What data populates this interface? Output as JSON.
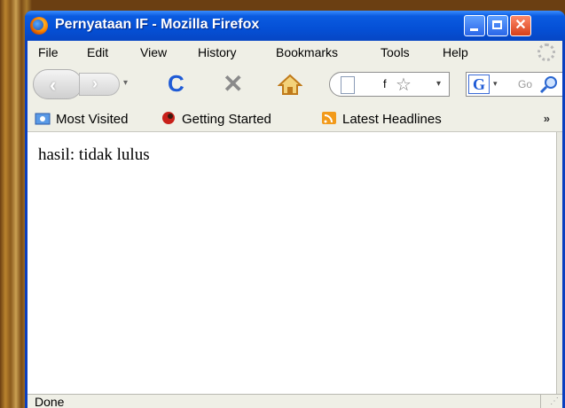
{
  "window": {
    "title": "Pernyataan IF - Mozilla Firefox",
    "close_glyph": "✕"
  },
  "menu": {
    "items": [
      {
        "label": "File"
      },
      {
        "label": "Edit"
      },
      {
        "label": "View"
      },
      {
        "label": "History"
      },
      {
        "label": "Bookmarks"
      },
      {
        "label": "Tools"
      },
      {
        "label": "Help"
      }
    ]
  },
  "nav": {
    "back_icon": "back-arrow-icon",
    "forward_icon": "forward-arrow-icon",
    "reload_glyph": "C",
    "stop_glyph": "✕",
    "back_glyph": "‹",
    "forward_glyph": "›",
    "dropdown_glyph": "▾",
    "url_text": "f",
    "star_glyph": "☆",
    "search_engine_glyph": "G",
    "search_placeholder": "Go"
  },
  "bookmarks": {
    "items": [
      {
        "label": "Most Visited"
      },
      {
        "label": "Getting Started"
      },
      {
        "label": "Latest Headlines"
      }
    ],
    "overflow": "»"
  },
  "page": {
    "text": "hasil: tidak lulus"
  },
  "status": {
    "text": "Done",
    "grip": "⋰"
  },
  "colors": {
    "titlebar": "#0550d6",
    "chrome": "#efefe6",
    "reload": "#1f5bd6"
  }
}
